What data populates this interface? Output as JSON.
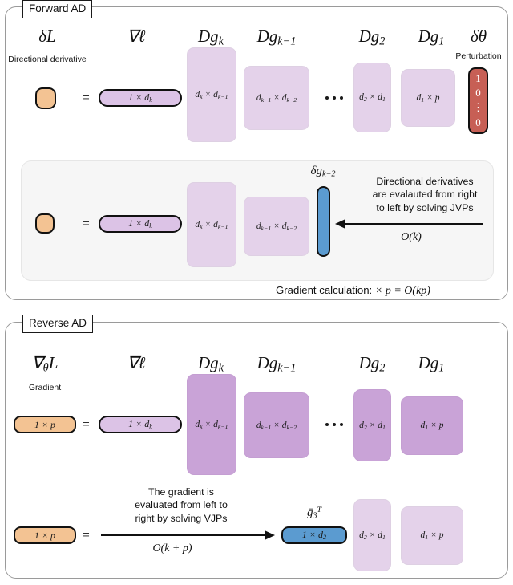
{
  "sections": {
    "forward": {
      "tab_label": "Forward AD",
      "row1": {
        "lhs_label": "δL",
        "lhs_sublabel": "Directional\nderivative",
        "lhs_box_text": "",
        "equals": "=",
        "grad_label": "∇ℓ",
        "grad_box_text": "1 × d_k",
        "columns": [
          {
            "head": "Dg_k",
            "box": "d_k × d_k−1"
          },
          {
            "head": "Dg_k−1",
            "box": "d_k−1 × d_k−2"
          },
          {
            "head": "Dg_2",
            "box": "d_2 × d_1"
          },
          {
            "head": "Dg_1",
            "box": "d_1 × p"
          }
        ],
        "perturbation": {
          "head": "δθ",
          "sublabel": "Perturbation",
          "entries": [
            "1",
            "0",
            "⋮",
            "0"
          ]
        }
      },
      "row2": {
        "lhs_box_text": "",
        "equals": "=",
        "grad_box_text": "1 × d_k",
        "boxes": [
          {
            "box": "d_k × d_k−1"
          },
          {
            "box": "d_k−1 × d_k−2"
          }
        ],
        "jvp_label": "δg_k−2",
        "note": "Directional derivatives\nare evalauted from right\nto left by solving JVPs",
        "complexity": "O(k)",
        "arrow_direction": "left"
      },
      "footer": {
        "caption": "Gradient calculation:",
        "expression": "× p = O(kp)"
      }
    },
    "reverse": {
      "tab_label": "Reverse AD",
      "row1": {
        "lhs_label": "∇_θ L",
        "lhs_sublabel": "Gradient",
        "lhs_box_text": "1 × p",
        "equals": "=",
        "grad_label": "∇ℓ",
        "grad_box_text": "1 × d_k",
        "columns": [
          {
            "head": "Dg_k",
            "box": "d_k × d_k−1"
          },
          {
            "head": "Dg_k−1",
            "box": "d_k−1 × d_k−2"
          },
          {
            "head": "Dg_2",
            "box": "d_2 × d_1"
          },
          {
            "head": "Dg_1",
            "box": "d_1 × p"
          }
        ]
      },
      "row2": {
        "lhs_box_text": "1 × p",
        "equals": "=",
        "note": "The gradient is\nevaluated from left to\nright by solving VJPs",
        "complexity": "O(k + p)",
        "arrow_direction": "right",
        "vjp_label": "ḡ_3^T",
        "vjp_box_text": "1 × d_2",
        "boxes": [
          {
            "box": "d_2 × d_1"
          },
          {
            "box": "d_1 × p"
          }
        ]
      }
    }
  },
  "colors": {
    "lavender": "#e4d2ea",
    "purple": "#c9a3d7",
    "orange": "#f3c393",
    "blue": "#5b9bd0",
    "red": "#c75f55",
    "outline": "#111111",
    "panel_bg": "#f6f6f6",
    "frame": "#9a9a9a"
  }
}
